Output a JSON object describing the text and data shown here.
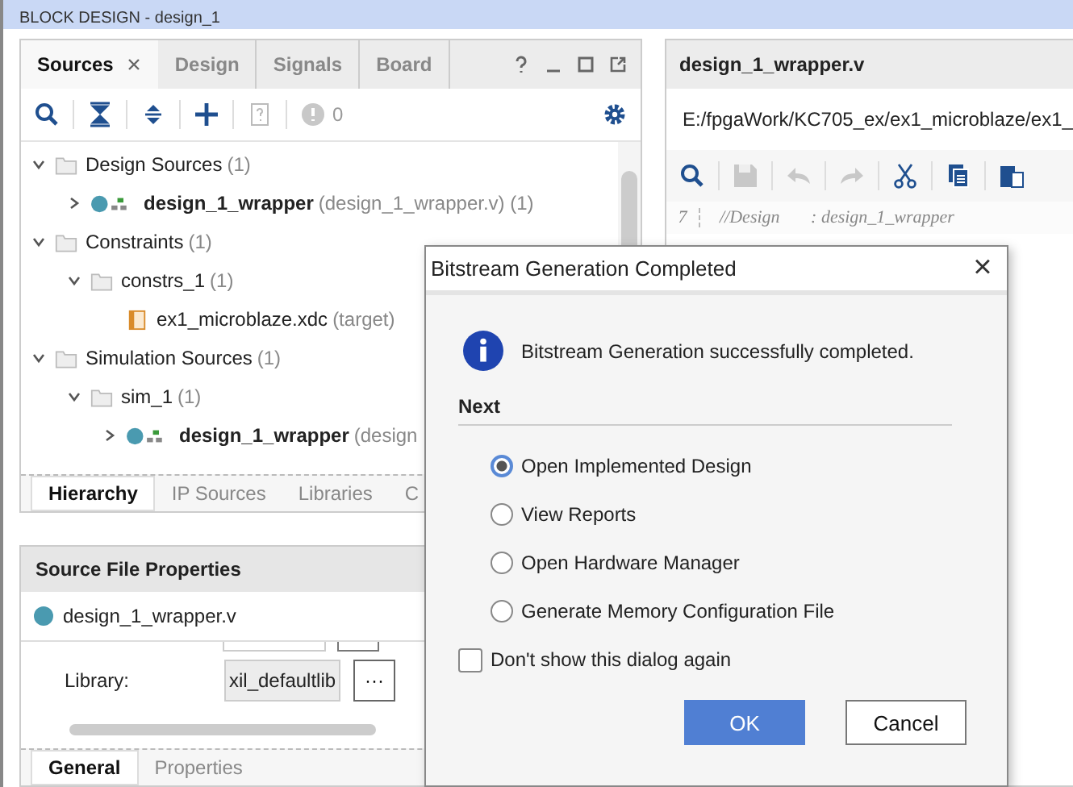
{
  "header": {
    "title": "BLOCK DESIGN - design_1"
  },
  "sources_panel": {
    "tabs": [
      {
        "label": "Sources",
        "selected": true,
        "closable": true
      },
      {
        "label": "Design",
        "selected": false
      },
      {
        "label": "Signals",
        "selected": false
      },
      {
        "label": "Board",
        "selected": false
      }
    ],
    "badge_count": "0",
    "tree": [
      {
        "kind": "folder",
        "label": "Design Sources",
        "detail": "(1)",
        "expanded": true,
        "children": [
          {
            "kind": "module",
            "label": "design_1_wrapper",
            "detail": "(design_1_wrapper.v) (1)",
            "expanded": false
          }
        ]
      },
      {
        "kind": "folder",
        "label": "Constraints",
        "detail": "(1)",
        "expanded": true,
        "children": [
          {
            "kind": "folder",
            "label": "constrs_1",
            "detail": "(1)",
            "expanded": true,
            "children": [
              {
                "kind": "file",
                "label": "ex1_microblaze.xdc",
                "detail": "(target)"
              }
            ]
          }
        ]
      },
      {
        "kind": "folder",
        "label": "Simulation Sources",
        "detail": "(1)",
        "expanded": true,
        "children": [
          {
            "kind": "folder",
            "label": "sim_1",
            "detail": "(1)",
            "expanded": true,
            "children": [
              {
                "kind": "module",
                "label": "design_1_wrapper",
                "detail": "(design",
                "expanded": false
              }
            ]
          }
        ]
      }
    ],
    "bottom_tabs": [
      {
        "label": "Hierarchy",
        "selected": true
      },
      {
        "label": "IP Sources",
        "selected": false
      },
      {
        "label": "Libraries",
        "selected": false
      },
      {
        "label": "C",
        "selected": false
      }
    ]
  },
  "properties_panel": {
    "title": "Source File Properties",
    "file": "design_1_wrapper.v",
    "library_label": "Library:",
    "library_value": "xil_defaultlib",
    "browse_button": "···",
    "tabs": [
      {
        "label": "General",
        "selected": true
      },
      {
        "label": "Properties",
        "selected": false
      }
    ]
  },
  "editor": {
    "title": "design_1_wrapper.v",
    "path": "E:/fpgaWork/KC705_ex/ex1_microblaze/ex1_",
    "lines": [
      {
        "number": "7",
        "text": "//Design       : design_1_wrapper"
      }
    ]
  },
  "dialog": {
    "title": "Bitstream Generation Completed",
    "close": "×",
    "message": "Bitstream Generation successfully completed.",
    "section": "Next",
    "options": [
      {
        "label": "Open Implemented Design",
        "selected": true
      },
      {
        "label": "View Reports",
        "selected": false
      },
      {
        "label": "Open Hardware Manager",
        "selected": false
      },
      {
        "label": "Generate Memory Configuration File",
        "selected": false
      }
    ],
    "dont_show": {
      "label": "Don't show this dialog again",
      "checked": false
    },
    "buttons": [
      {
        "label": "OK",
        "kind": "primary"
      },
      {
        "label": "Cancel",
        "kind": "secondary"
      }
    ]
  }
}
